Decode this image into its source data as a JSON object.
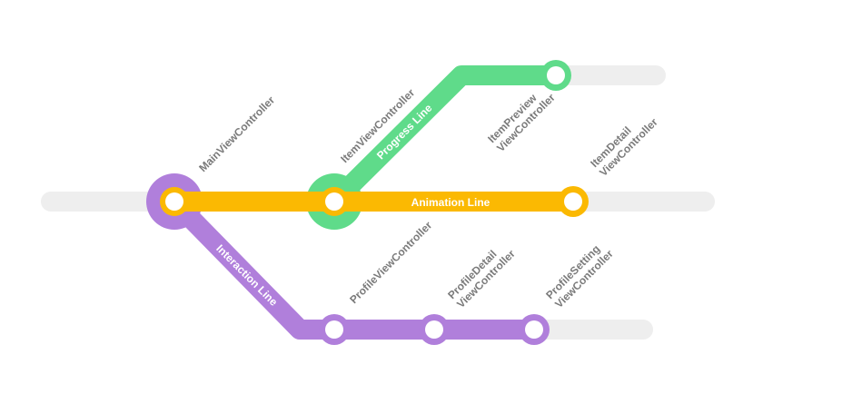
{
  "colors": {
    "track": "#eeeeee",
    "progress": "#5fdb8a",
    "animation": "#fbb902",
    "interaction": "#b07fdb",
    "label": "#7a7a7a",
    "station_fill": "#ffffff"
  },
  "lines": {
    "progress": {
      "label": "Progress Line"
    },
    "animation": {
      "label": "Animation Line"
    },
    "interaction": {
      "label": "Interaction Line"
    }
  },
  "stations": {
    "main": {
      "line1": "MainViewController"
    },
    "item": {
      "line1": "ItemViewController"
    },
    "item_preview": {
      "line1": "ItemPreview",
      "line2": "ViewController"
    },
    "item_detail": {
      "line1": "ItemDetail",
      "line2": "ViewController"
    },
    "profile": {
      "line1": "ProfileViewController"
    },
    "profile_detail": {
      "line1": "ProfileDetail",
      "line2": "ViewController"
    },
    "profile_setting": {
      "line1": "ProfileSetting",
      "line2": "ViewController"
    }
  }
}
